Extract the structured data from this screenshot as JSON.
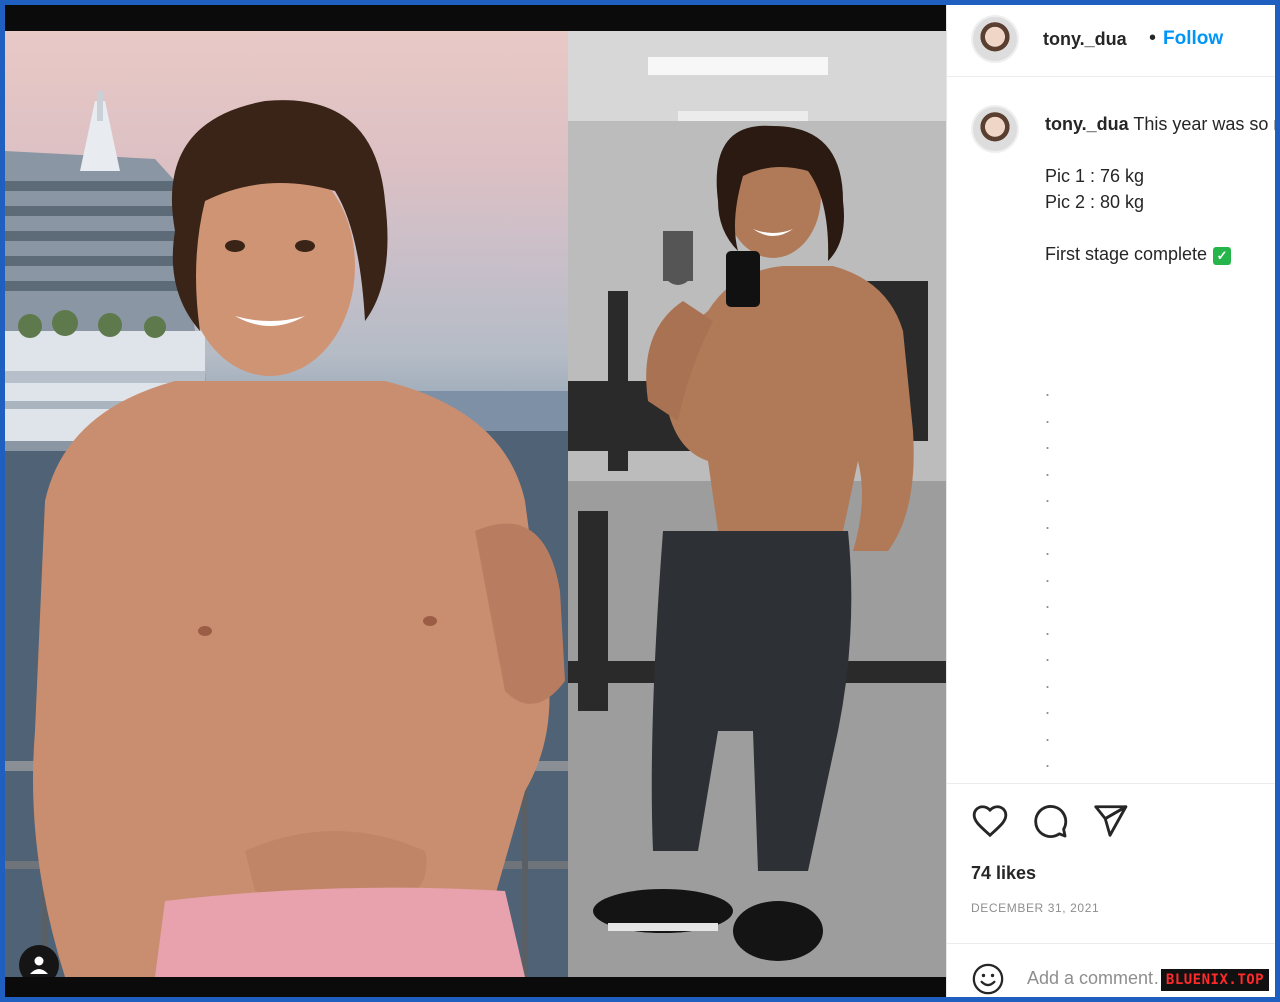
{
  "post": {
    "username": "tony._dua",
    "separator": "•",
    "follow_label": "Follow",
    "caption": {
      "username": "tony._dua",
      "line1": "This year was so rewarding…",
      "line2": "Pic 1 : 76 kg",
      "line3": "Pic 2 : 80 kg",
      "line4": "First stage complete",
      "dots": [
        ".",
        ".",
        ".",
        ".",
        ".",
        ".",
        ".",
        ".",
        ".",
        ".",
        ".",
        ".",
        ".",
        ".",
        ".",
        ".",
        ".",
        "."
      ]
    },
    "likes": "74 likes",
    "date": "DECEMBER 31, 2021",
    "comment_placeholder": "Add a comment…"
  },
  "icons": {
    "like": "heart-icon",
    "comment": "comment-bubble-icon",
    "share": "paper-plane-icon",
    "emoji": "emoji-icon",
    "user_tag": "user-tag-icon",
    "check": "check-mark-icon"
  },
  "colors": {
    "follow": "#0095f6",
    "check": "#25b54a",
    "frame_border": "#1f5fbf",
    "watermark_text": "#ff2a2a"
  },
  "watermark": "BLUENIX.TOP"
}
